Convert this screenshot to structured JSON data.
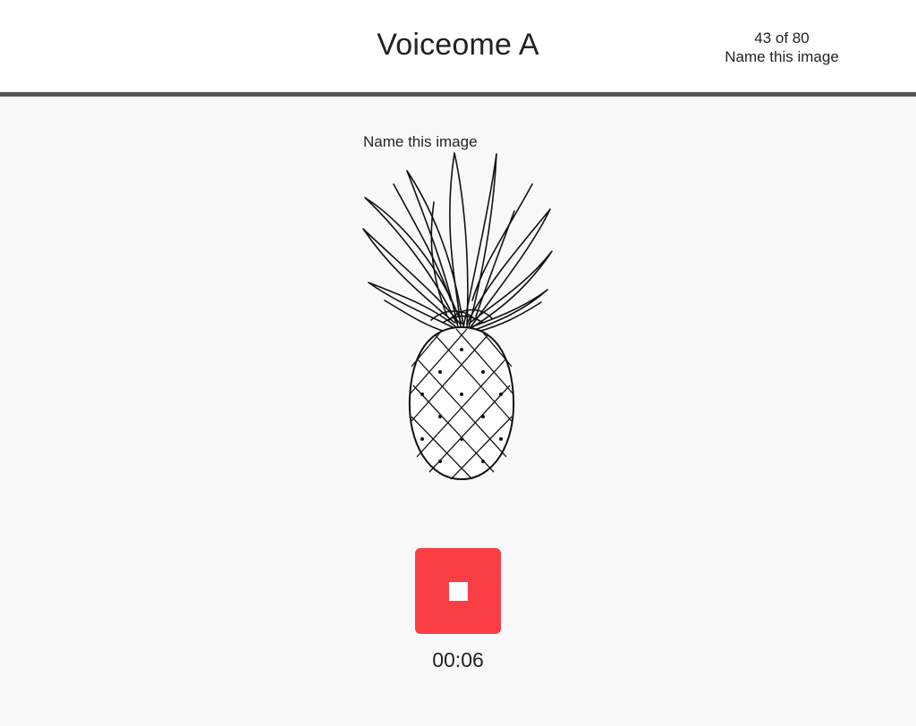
{
  "header": {
    "title": "Voiceome A",
    "progress": "43 of 80",
    "task_name": "Name this image"
  },
  "task": {
    "prompt": "Name this image",
    "stimulus_icon": "pineapple-drawing",
    "record_button_icon": "stop-icon",
    "record_button_color": "#f93e44",
    "timer": "00:06"
  }
}
